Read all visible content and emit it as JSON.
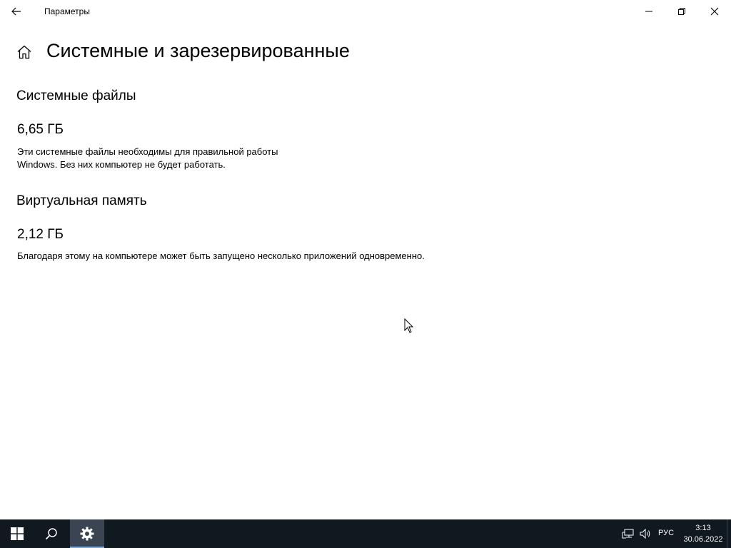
{
  "window": {
    "title": "Параметры"
  },
  "page": {
    "title": "Системные и зарезервированные"
  },
  "sections": [
    {
      "heading": "Системные файлы",
      "size": "6,65 ГБ",
      "description_line1": "Эти системные файлы необходимы для правильной работы",
      "description_line2": "Windows. Без них компьютер не будет работать."
    },
    {
      "heading": "Виртуальная память",
      "size": "2,12 ГБ",
      "description_line1": "Благодаря этому на компьютере может быть запущено несколько приложений одновременно."
    }
  ],
  "taskbar": {
    "language": "РУС",
    "time": "3:13",
    "date": "30.06.2022",
    "items": [
      "start-icon",
      "search-icon",
      "settings-gear-icon"
    ],
    "tray": [
      "network-icon",
      "volume-icon"
    ]
  },
  "colors": {
    "taskbar_bg": "#101820",
    "active_app_bg": "#3a4452",
    "active_app_indicator": "#7aa9d9",
    "window_bg": "#ffffff"
  }
}
